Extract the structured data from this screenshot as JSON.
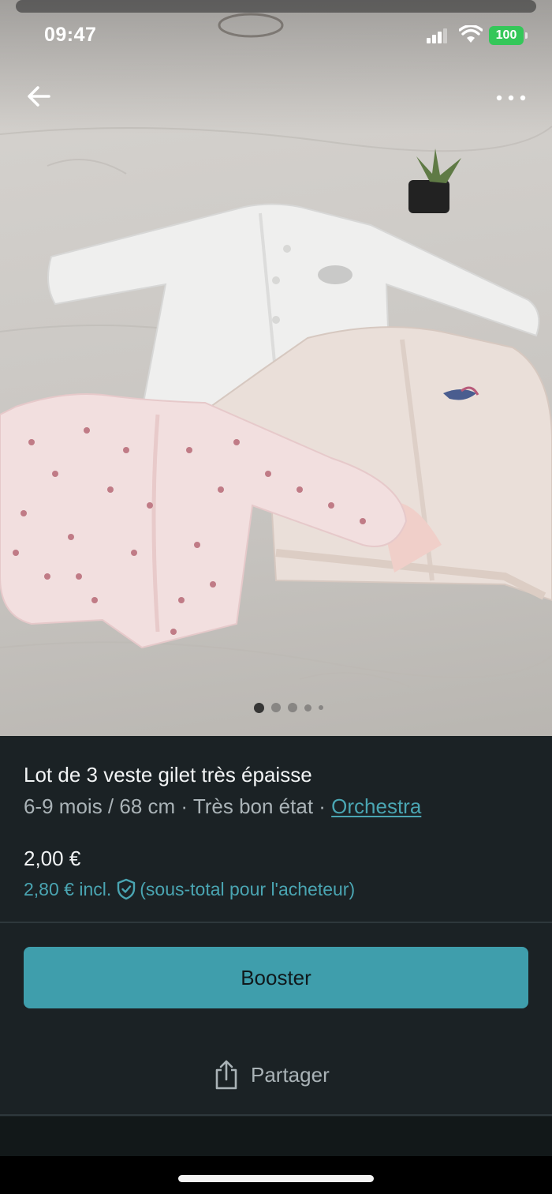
{
  "status_bar": {
    "time": "09:47",
    "battery": "100"
  },
  "nav": {
    "back_icon": "arrow-left-icon",
    "more_icon": "more-horizontal-icon"
  },
  "gallery": {
    "total_images": 5,
    "active_index": 0
  },
  "listing": {
    "title": "Lot de 3 veste gilet très épaisse",
    "size": "6-9 mois / 68 cm",
    "separator": " · ",
    "condition": "Très bon état",
    "brand": "Orchestra",
    "price": "2,00 €",
    "price_incl": "2,80 € incl.",
    "price_note": "(sous-total pour l'acheteur)"
  },
  "actions": {
    "booster_label": "Booster",
    "share_label": "Partager"
  },
  "colors": {
    "background": "#1b2225",
    "accent": "#3f9eac",
    "link": "#4aa5b2",
    "muted_text": "#aab3b7",
    "battery": "#34c759"
  }
}
